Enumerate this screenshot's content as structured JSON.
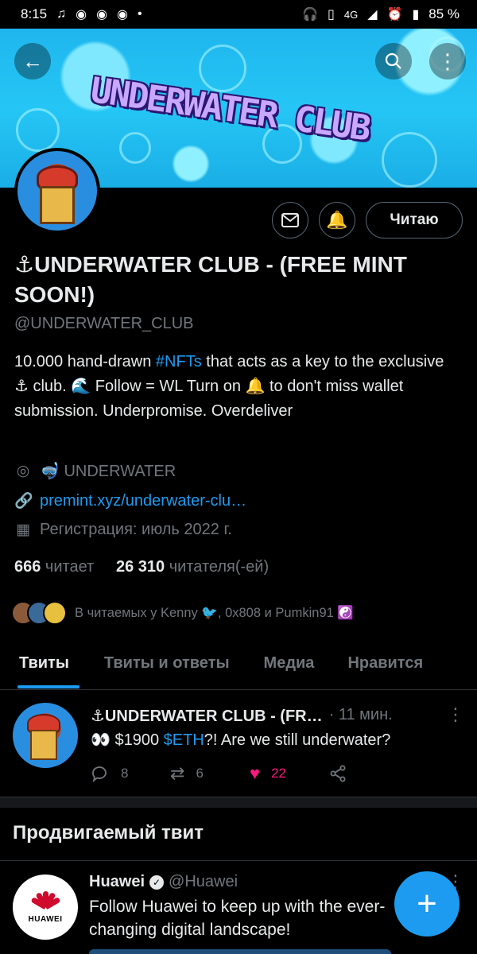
{
  "status_bar": {
    "time": "8:15",
    "network": "4G",
    "battery": "85 %"
  },
  "banner": {
    "title": "UNDERWATER CLUB"
  },
  "profile": {
    "name": "⚓UNDERWATER CLUB - (FREE MINT SOON!)",
    "handle": "@UNDERWATER_CLUB",
    "follow_button": "Читаю",
    "bio": {
      "part1": "10.000 hand-drawn ",
      "hashtag": "#NFTs",
      "part2": " that acts as a key to the exclusive ⚓ club. 🌊 Follow = WL Turn on 🔔 to don't miss wallet submission.  Underpromise. Overdeliver"
    },
    "location": "🤿 UNDERWATER",
    "website": "premint.xyz/underwater-clu…",
    "joined": "Регистрация: июль 2022 г.",
    "following_count": "666",
    "following_label": " читает",
    "followers_count": "26 310",
    "followers_label": " читателя(-ей)",
    "followed_by": "В читаемых у Kenny 🐦, 0x808 и Pumkin91 ☯️"
  },
  "tabs": [
    "Твиты",
    "Твиты и ответы",
    "Медиа",
    "Нравится"
  ],
  "tweet": {
    "author": "⚓UNDERWATER CLUB - (FR…",
    "time": "· 11 мин.",
    "text_pre": "👀 $1900 ",
    "cashtag": "$ETH",
    "text_post": "?! Are we still underwater?",
    "replies": "8",
    "retweets": "6",
    "likes": "22"
  },
  "promoted": {
    "section_title": "Продвигаемый твит",
    "author": "Huawei",
    "handle": "@Huawei",
    "logo_text": "HUAWEI",
    "text": "Follow Huawei to keep up with the ever-changing digital landscape!"
  },
  "colors": {
    "accent": "#1d9bf0",
    "like": "#f91880",
    "background": "#000000",
    "muted": "#71767b"
  }
}
